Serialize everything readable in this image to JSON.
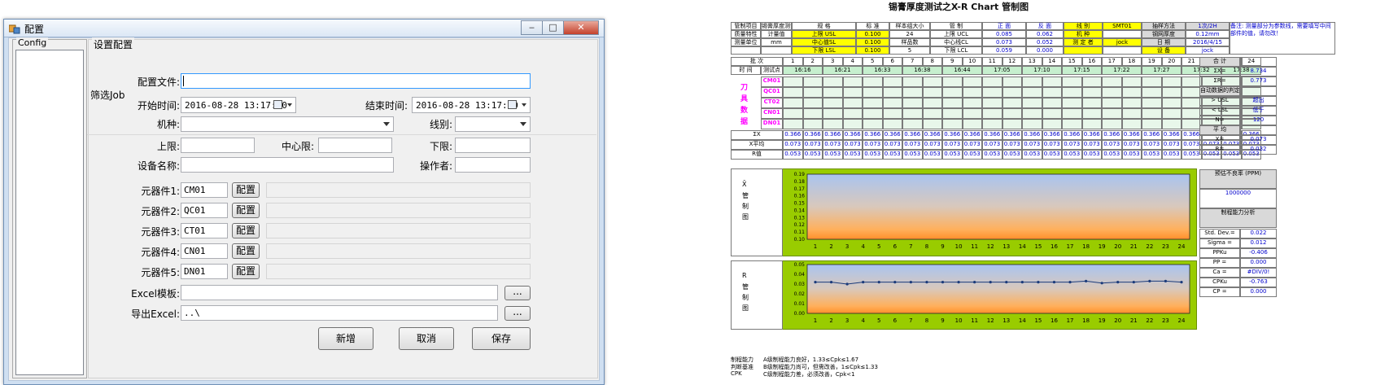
{
  "window": {
    "title": "配置",
    "min_label": "‒",
    "max_label": "□",
    "close_label": "✕"
  },
  "config_group": {
    "legend": "Config"
  },
  "settings": {
    "legend": "设置配置",
    "filter_label": "筛选Job",
    "config_file_label": "配置文件:",
    "config_file_value": "",
    "start_time_label": "开始时间:",
    "start_time_value": "2016-08-28 13:17:00",
    "end_time_label": "结束时间:",
    "end_time_value": "2016-08-28 13:17:00",
    "machine_label": "机种:",
    "line_label": "线别:",
    "upper_label": "上限:",
    "center_label": "中心限:",
    "lower_label": "下限:",
    "device_label": "设备名称:",
    "operator_label": "操作者:",
    "components": [
      {
        "label": "元器件1:",
        "value": "CM01",
        "button": "配置"
      },
      {
        "label": "元器件2:",
        "value": "QC01",
        "button": "配置"
      },
      {
        "label": "元器件3:",
        "value": "CT01",
        "button": "配置"
      },
      {
        "label": "元器件4:",
        "value": "CN01",
        "button": "配置"
      },
      {
        "label": "元器件5:",
        "value": "DN01",
        "button": "配置"
      }
    ],
    "excel_template_label": "Excel模板:",
    "excel_template_value": "",
    "browse_label": "...",
    "export_label": "导出Excel:",
    "export_value": "..\\",
    "add_button": "新增",
    "cancel_button": "取消",
    "save_button": "保存"
  },
  "sheet": {
    "title": "锡膏厚度测试之X-R Chart 管制图",
    "header_rows": [
      [
        "管制项目",
        "锡膏厚度测试",
        "规 格",
        "标 准",
        "样本组大小",
        "管 制",
        "正 面",
        "反 面",
        "线 别",
        "SMT01",
        "抽样方法",
        "1次/2H"
      ],
      [
        "质量特性",
        "计量值",
        "上限 USL",
        "0.100",
        "24",
        "上限 UCL",
        "0.085",
        "0.062",
        "机 种",
        "",
        "钢网厚度",
        "0.12mm"
      ],
      [
        "测量单位",
        "mm",
        "中心值SL",
        "0.100",
        "样品数",
        "中心线CL",
        "0.073",
        "0.052",
        "测 定 者",
        "jock",
        "日 期",
        "2016/4/15"
      ],
      [
        "",
        "",
        "下限 LSL",
        "0.100",
        "5",
        "下限 LCL",
        "0.059",
        "0.000",
        "",
        "",
        "设 备",
        "jock"
      ]
    ],
    "note": "备注: 测量部分为参数线，需要填写中间部件的值，请勿改！",
    "groups_label": "批 次",
    "time_label": "时 间",
    "test_label": "测试点",
    "groups": [
      "1",
      "2",
      "3",
      "4",
      "5",
      "6",
      "7",
      "8",
      "9",
      "10",
      "11",
      "12",
      "13",
      "14",
      "15",
      "16",
      "17",
      "18",
      "19",
      "20",
      "21",
      "22",
      "23",
      "24"
    ],
    "times": [
      "16:16",
      "16:21",
      "16:33",
      "16:38",
      "16:44",
      "17:05",
      "17:10",
      "17:15",
      "17:22",
      "17:27",
      "17:32",
      "17:38"
    ],
    "component_rows": [
      "CM01",
      "QC01",
      "CT02",
      "CN01",
      "DN01"
    ],
    "side_labels": [
      "刀",
      "具",
      "数",
      "据"
    ],
    "sum_labels": [
      "ΣX",
      "X平均",
      "R值"
    ],
    "sum_values": {
      "sigma_x": "0.366",
      "x_avg": "0.073",
      "r": "0.053"
    },
    "right_stats": [
      {
        "label": "合 计",
        "value": ""
      },
      {
        "label": "ΣX=",
        "value": "8.734"
      },
      {
        "label": "ΣR=",
        "value": "0.773"
      },
      {
        "label": "自动数据的判定条件",
        "value": ""
      },
      {
        "label": ">  USL",
        "value": "超出"
      },
      {
        "label": "<  LSL",
        "value": "低于"
      },
      {
        "label": "N=",
        "value": "120"
      },
      {
        "label": "平 均",
        "value": ""
      },
      {
        "label": "X=",
        "value": "0.073"
      },
      {
        "label": "R=",
        "value": "0.032"
      }
    ],
    "defect_title": "预估不良率 (PPM)",
    "defect_value": "1000000",
    "capability_title": "制程能力分析",
    "capability": [
      {
        "label": "Std. Dev.=",
        "value": "0.022"
      },
      {
        "label": "Sigma =",
        "value": "0.012"
      },
      {
        "label": "PPKu",
        "value": "-0.406"
      },
      {
        "label": "PP =",
        "value": "0.000"
      },
      {
        "label": "Ca =",
        "value": "#DIV/0!"
      },
      {
        "label": "CPKu",
        "value": "-0.763"
      },
      {
        "label": "CP =",
        "value": "0.000"
      }
    ],
    "xbar_side": [
      "X̄",
      "管",
      "制",
      "图"
    ],
    "r_side": [
      "R",
      "管",
      "制",
      "图"
    ],
    "capability_text_label": [
      "制程能力",
      "判断基准",
      "CPK"
    ],
    "capability_text": [
      "A级制程能力良好，1.33≤Cpk≤1.67",
      "B级制程能力尚可，但需改善，1≤Cpk≤1.33",
      "C级制程能力差，必须改善，Cpk<1"
    ]
  },
  "chart_data": [
    {
      "type": "line",
      "title": "",
      "x": [
        1,
        2,
        3,
        4,
        5,
        6,
        7,
        8,
        9,
        10,
        11,
        12,
        13,
        14,
        15,
        16,
        17,
        18,
        19,
        20,
        21,
        22,
        23,
        24
      ],
      "ylim": [
        0.1,
        0.19
      ],
      "yticks": [
        "0.19",
        "0.18",
        "0.17",
        "0.16",
        "0.15",
        "0.14",
        "0.13",
        "0.12",
        "0.11",
        "0.10"
      ],
      "series": []
    },
    {
      "type": "line",
      "title": "",
      "x": [
        1,
        2,
        3,
        4,
        5,
        6,
        7,
        8,
        9,
        10,
        11,
        12,
        13,
        14,
        15,
        16,
        17,
        18,
        19,
        20,
        21,
        22,
        23,
        24
      ],
      "ylim": [
        0.0,
        0.05
      ],
      "yticks": [
        "0.05",
        "0.04",
        "0.03",
        "0.02",
        "0.01",
        "0.00"
      ],
      "series": [
        {
          "values": [
            0.032,
            0.032,
            0.03,
            0.032,
            0.032,
            0.032,
            0.032,
            0.032,
            0.032,
            0.032,
            0.032,
            0.032,
            0.032,
            0.032,
            0.032,
            0.032,
            0.032,
            0.033,
            0.031,
            0.032,
            0.032,
            0.033,
            0.033,
            0.032
          ]
        }
      ]
    }
  ]
}
